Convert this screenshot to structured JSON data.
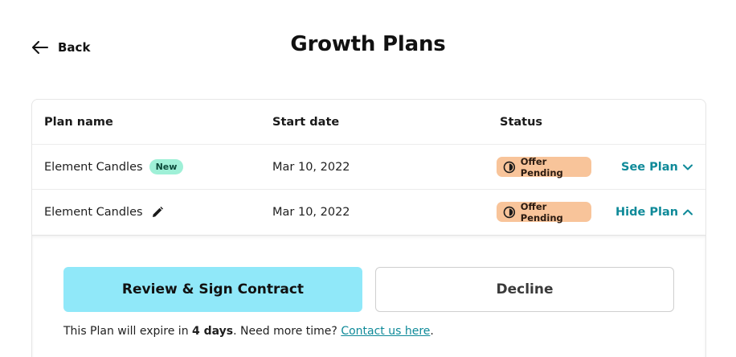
{
  "header": {
    "back_label": "Back",
    "title": "Growth Plans"
  },
  "table": {
    "columns": [
      "Plan name",
      "Start date",
      "Status"
    ],
    "rows": [
      {
        "name": "Element Candles",
        "badge": "New",
        "start_date": "Mar 10, 2022",
        "status": "Offer Pending",
        "action": "See Plan",
        "action_icon": "chevron-down-icon"
      },
      {
        "name": "Element Candles",
        "edit_icon": "pencil-icon",
        "start_date": "Mar 10, 2022",
        "status": "Offer Pending",
        "action": "Hide Plan",
        "action_icon": "chevron-up-icon"
      }
    ]
  },
  "plan_detail": {
    "review_button": "Review & Sign Contract",
    "decline_button": "Decline",
    "expire_prefix": "This Plan will expire in ",
    "expire_days": "4 days",
    "expire_middle": ". Need more time? ",
    "contact_link": "Contact us here",
    "expire_suffix": "."
  },
  "colors": {
    "accent": "#0f8a99",
    "primary_button": "#90e8f9",
    "status_pill": "#f8c49a",
    "new_badge": "#9ff0d7"
  }
}
